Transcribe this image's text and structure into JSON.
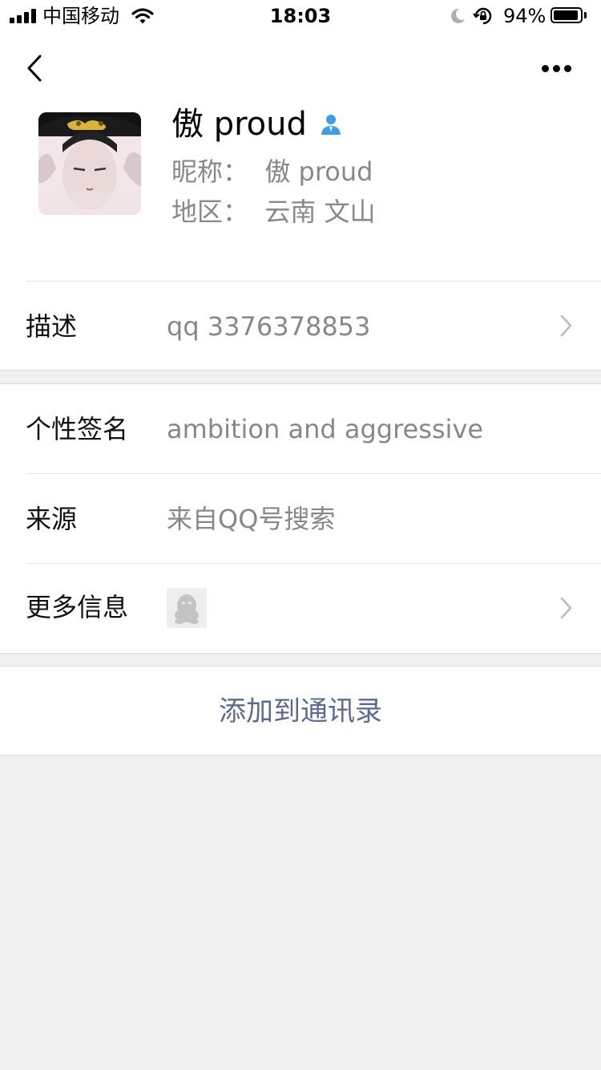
{
  "status_bar": {
    "carrier": "中国移动",
    "time": "18:03",
    "battery_percent": "94%",
    "battery_level": 0.94,
    "icons": [
      "signal-icon",
      "wifi-icon",
      "moon-icon",
      "rotation-lock-icon",
      "battery-icon"
    ]
  },
  "nav": {
    "back_icon": "chevron-left-icon",
    "more_icon": "more-dots-icon"
  },
  "profile": {
    "name": "傲 proud",
    "nickname_line": "昵称：  傲 proud",
    "region_line": "地区：  云南 文山",
    "badge_icon": "contact-person-icon",
    "badge_color": "#3d9ee6"
  },
  "rows": {
    "description": {
      "label": "描述",
      "value": "qq 3376378853"
    },
    "signature": {
      "label": "个性签名",
      "value": "ambition and aggressive"
    },
    "source": {
      "label": "来源",
      "value": "来自QQ号搜索"
    },
    "more_info": {
      "label": "更多信息",
      "thumb_icon": "qq-penguin-icon"
    }
  },
  "actions": {
    "add_to_contacts": "添加到通讯录",
    "link_color": "#576b95"
  }
}
